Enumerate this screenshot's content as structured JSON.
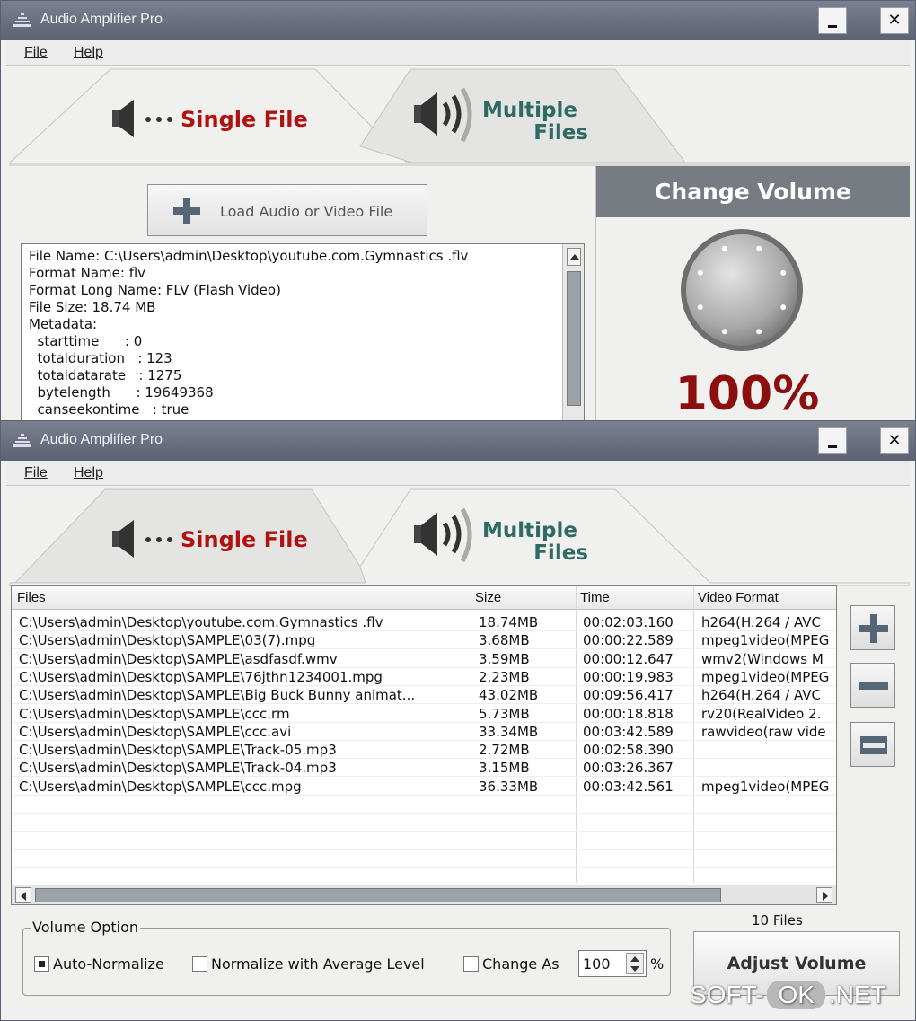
{
  "app": {
    "title": "Audio Amplifier Pro",
    "close_glyph": "✕"
  },
  "menu": {
    "file": "File",
    "help": "Help"
  },
  "tabs": {
    "single_file": "Single File",
    "multiple_files_line1": "Multiple",
    "multiple_files_line2": "Files"
  },
  "single": {
    "load_button": "Load Audio or Video File",
    "info_lines": [
      "File Name: C:\\Users\\admin\\Desktop\\youtube.com.Gymnastics .flv",
      "Format Name: flv",
      "Format Long Name: FLV (Flash Video)",
      "File Size: 18.74 MB",
      "Metadata:",
      "  starttime      : 0",
      "  totalduration   : 123",
      "  totaldatarate   : 1275",
      "  bytelength      : 19649368",
      "  canseekontime   : true"
    ],
    "volume_header": "Change Volume",
    "volume_percent": "100%",
    "volume_level": 1.0
  },
  "multiple": {
    "columns": [
      "Files",
      "Size",
      "Time",
      "Video Format"
    ],
    "rows": [
      [
        "C:\\Users\\admin\\Desktop\\youtube.com.Gymnastics .flv",
        "18.74MB",
        "00:02:03.160",
        "h264(H.264 / AVC"
      ],
      [
        "C:\\Users\\admin\\Desktop\\SAMPLE\\03(7).mpg",
        "3.68MB",
        "00:00:22.589",
        "mpeg1video(MPEG"
      ],
      [
        "C:\\Users\\admin\\Desktop\\SAMPLE\\asdfasdf.wmv",
        "3.59MB",
        "00:00:12.647",
        "wmv2(Windows M"
      ],
      [
        "C:\\Users\\admin\\Desktop\\SAMPLE\\76jthn1234001.mpg",
        "2.23MB",
        "00:00:19.983",
        "mpeg1video(MPEG"
      ],
      [
        "C:\\Users\\admin\\Desktop\\SAMPLE\\Big Buck Bunny animat...",
        "43.02MB",
        "00:09:56.417",
        "h264(H.264 / AVC"
      ],
      [
        "C:\\Users\\admin\\Desktop\\SAMPLE\\ccc.rm",
        "5.73MB",
        "00:00:18.818",
        "rv20(RealVideo 2."
      ],
      [
        "C:\\Users\\admin\\Desktop\\SAMPLE\\ccc.avi",
        "33.34MB",
        "00:03:42.589",
        "rawvideo(raw vide"
      ],
      [
        "C:\\Users\\admin\\Desktop\\SAMPLE\\Track-05.mp3",
        "2.72MB",
        "00:02:58.390",
        ""
      ],
      [
        "C:\\Users\\admin\\Desktop\\SAMPLE\\Track-04.mp3",
        "3.15MB",
        "00:03:26.367",
        ""
      ],
      [
        "C:\\Users\\admin\\Desktop\\SAMPLE\\ccc.mpg",
        "36.33MB",
        "00:03:42.561",
        "mpeg1video(MPEG"
      ]
    ],
    "files_count": "10 Files",
    "volume_option": {
      "legend": "Volume Option",
      "auto_normalize": "Auto-Normalize",
      "auto_normalize_checked": true,
      "normalize_avg": "Normalize with Average Level",
      "normalize_avg_checked": false,
      "change_as": "Change As",
      "change_as_checked": false,
      "change_value": "100",
      "percent_sign": "%"
    },
    "adjust_button": "Adjust Volume"
  },
  "watermark": {
    "left": "SOFT-",
    "ok": "OK",
    "right": ".NET"
  },
  "colors": {
    "titlebar": "#6a7080",
    "red_label": "#b01212",
    "teal_label": "#2f6b63",
    "volume_pct": "#8b0f0f",
    "header_grey": "#777b82"
  }
}
